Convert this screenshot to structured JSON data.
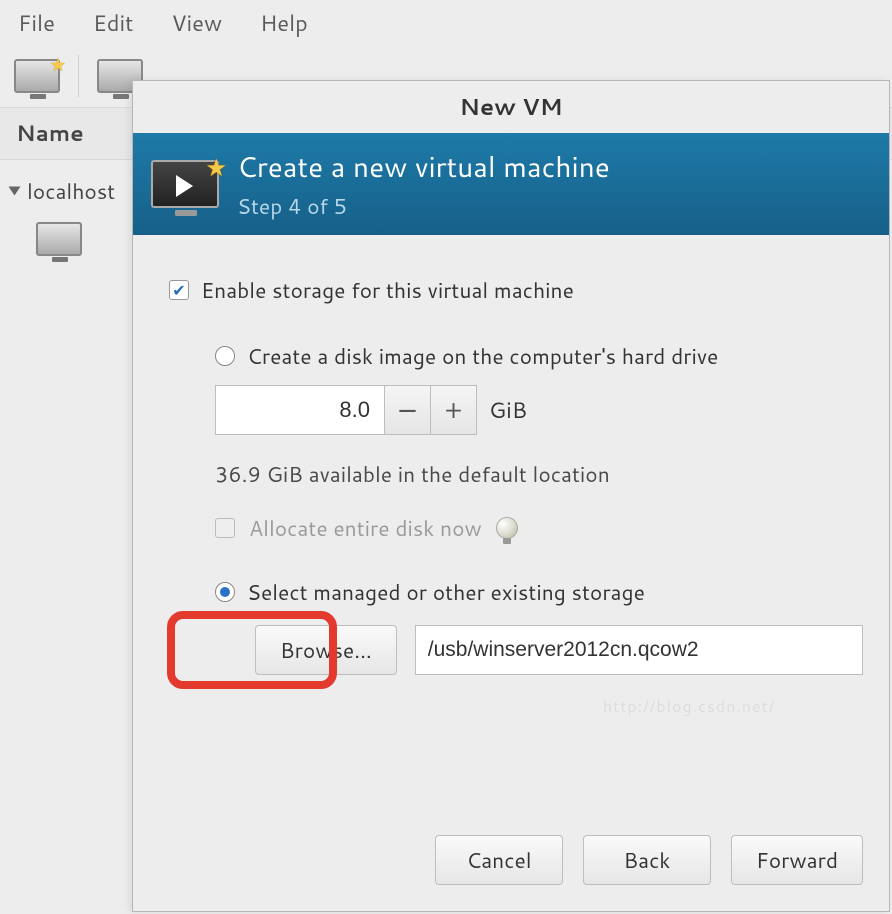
{
  "menubar": {
    "items": [
      "File",
      "Edit",
      "View",
      "Help"
    ]
  },
  "list": {
    "header": "Name",
    "host": "localhost"
  },
  "dialog": {
    "title": "New VM",
    "header_title": "Create a new virtual machine",
    "header_step": "Step 4 of 5",
    "enable_storage_label": "Enable storage for this virtual machine",
    "create_disk_label": "Create a disk image on the computer's hard drive",
    "disk_size_value": "8.0",
    "disk_size_unit": "GiB",
    "available_hint": "36.9 GiB available in the default location",
    "allocate_label": "Allocate entire disk now",
    "select_existing_label": "Select managed or other existing storage",
    "browse_label": "Browse...",
    "storage_path": "/usb/winserver2012cn.qcow2",
    "buttons": {
      "cancel": "Cancel",
      "back": "Back",
      "forward": "Forward"
    }
  },
  "watermark": "http://blog.csdn.net/"
}
